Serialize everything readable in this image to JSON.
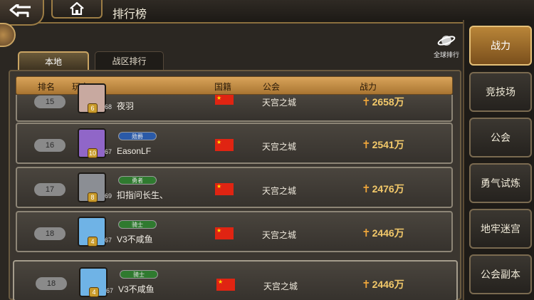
{
  "header": {
    "title": "排行榜"
  },
  "global_rank_label": "全球排行",
  "tabs": [
    {
      "label": "本地",
      "active": true
    },
    {
      "label": "战区排行",
      "active": false
    }
  ],
  "columns": {
    "rank": "排名",
    "player": "玩家",
    "country": "国籍",
    "guild": "公会",
    "power": "战力"
  },
  "rows": [
    {
      "rank": "15",
      "name": "夜羽",
      "title": "",
      "level": "68",
      "stars": "6",
      "guild": "天宫之城",
      "power": "2658万",
      "avatar_color": "#c8a9a0"
    },
    {
      "rank": "16",
      "name": "EasonLF",
      "title": "勋爵",
      "level": "67",
      "stars": "10",
      "guild": "天宫之城",
      "power": "2541万",
      "avatar_color": "#9066c8",
      "title_color": "#2a5aa8"
    },
    {
      "rank": "17",
      "name": "扣指问长生、",
      "title": "勇者",
      "level": "69",
      "stars": "8",
      "guild": "天宫之城",
      "power": "2476万",
      "avatar_color": "#8b8e94",
      "title_color": "#2f7a2f"
    },
    {
      "rank": "18",
      "name": "V3不咸鱼",
      "title": "骑士",
      "level": "67",
      "stars": "4",
      "guild": "天宫之城",
      "power": "2446万",
      "avatar_color": "#6fb3e6",
      "title_color": "#2f7a2f"
    },
    {
      "rank": "18",
      "name": "V3不咸鱼",
      "title": "骑士",
      "level": "67",
      "stars": "4",
      "guild": "天宫之城",
      "power": "2446万",
      "avatar_color": "#6fb3e6",
      "title_color": "#2f7a2f"
    }
  ],
  "sidebar": [
    {
      "label": "战力",
      "active": true
    },
    {
      "label": "竞技场",
      "active": false
    },
    {
      "label": "公会",
      "active": false
    },
    {
      "label": "勇气试炼",
      "active": false
    },
    {
      "label": "地牢迷宫",
      "active": false
    },
    {
      "label": "公会副本",
      "active": false
    }
  ]
}
